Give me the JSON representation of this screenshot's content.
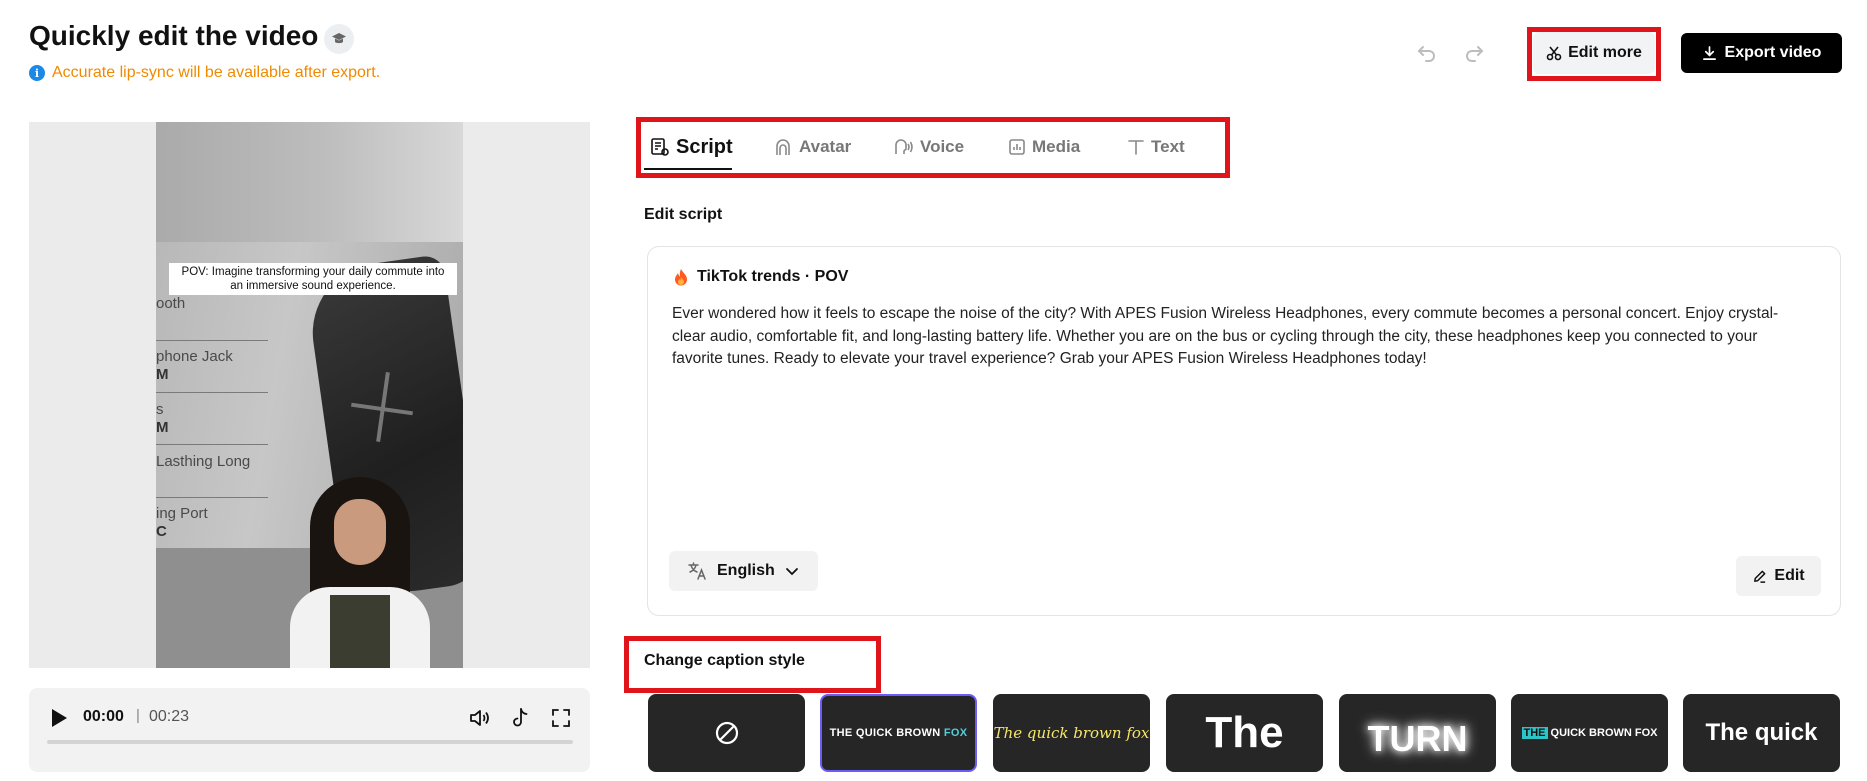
{
  "header": {
    "title": "Quickly edit the video",
    "notice": "Accurate lip-sync will be available after export.",
    "edit_more_label": "Edit more",
    "export_label": "Export video"
  },
  "video": {
    "caption": "POV: Imagine transforming your daily commute into an immersive sound experience.",
    "spec_lines": [
      "ooth",
      "phone Jack",
      "M",
      "s",
      "M",
      "Lasthing Long",
      "ing Port",
      "C"
    ]
  },
  "player": {
    "current_time": "00:00",
    "separator": "|",
    "total_time": "00:23",
    "progress": 0
  },
  "tabs": [
    {
      "label": "Script",
      "icon": "script-icon",
      "active": true
    },
    {
      "label": "Avatar",
      "icon": "avatar-icon",
      "active": false
    },
    {
      "label": "Voice",
      "icon": "voice-icon",
      "active": false
    },
    {
      "label": "Media",
      "icon": "media-icon",
      "active": false
    },
    {
      "label": "Text",
      "icon": "text-icon",
      "active": false
    }
  ],
  "script": {
    "section_label": "Edit script",
    "trend_label": "TikTok trends · POV",
    "body": "Ever wondered how it feels to escape the noise of the city? With APES Fusion Wireless Headphones, every commute becomes a personal concert. Enjoy crystal-clear audio, comfortable fit, and long-lasting battery life. Whether you are on the bus or cycling through the city, these headphones keep you connected to your favorite tunes. Ready to elevate your travel experience? Grab your APES Fusion Wireless Headphones today!",
    "language": "English",
    "edit_label": "Edit"
  },
  "caption_styles": {
    "section_label": "Change caption style",
    "items": [
      {
        "id": "none",
        "text": ""
      },
      {
        "id": "quick-brown-fox-caps",
        "text_a": "THE QUICK BROWN ",
        "text_b": "FOX"
      },
      {
        "id": "yellow-italic",
        "text": "The quick brown fox"
      },
      {
        "id": "bold-the",
        "text": "The"
      },
      {
        "id": "glow-turn",
        "text": "TURN"
      },
      {
        "id": "boxed-the",
        "text_a": "THE",
        "text_b": " QUICK BROWN FOX"
      },
      {
        "id": "bold-quick",
        "text": "The quick"
      }
    ],
    "selected_index": 1
  },
  "colors": {
    "notice": "#f08a00",
    "highlight": "#e0151c",
    "selected_border": "#6a5cf5",
    "accent_cyan": "#4fd1d9"
  }
}
